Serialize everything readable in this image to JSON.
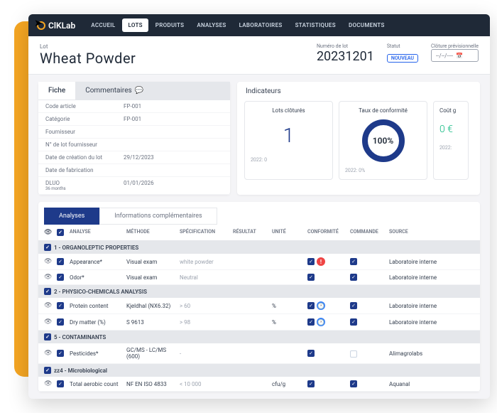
{
  "brand": "ClKLab",
  "nav": [
    "ACCUEIL",
    "LOTS",
    "PRODUITS",
    "ANALYSES",
    "LABORATOIRES",
    "STATISTIQUES",
    "DOCUMENTS"
  ],
  "nav_active": 1,
  "header": {
    "sub": "Lot",
    "title": "Wheat Powder",
    "lot_label": "Numéro de lot",
    "lot_value": "20231201",
    "status_label": "Statut",
    "status_value": "NOUVEAU",
    "close_label": "Clôture prévisionnelle",
    "close_value": "--/--/----"
  },
  "fiche": {
    "tab1": "Fiche",
    "tab2": "Commentaires",
    "rows": [
      {
        "k": "Code article",
        "v": "FP-001"
      },
      {
        "k": "Catégorie",
        "v": "FP-001"
      },
      {
        "k": "Fournisseur",
        "v": ""
      },
      {
        "k": "N° de lot fournisseur",
        "v": ""
      },
      {
        "k": "Date de création du lot",
        "v": "29/12/2023"
      },
      {
        "k": "Date de fabrication",
        "v": ""
      },
      {
        "k": "DLUO",
        "sub": "36 months",
        "v": "01/01/2026"
      }
    ]
  },
  "indicators": {
    "title": "Indicateurs",
    "cards": [
      {
        "title": "Lots clôturés",
        "value": "1",
        "foot": "2022: 0"
      },
      {
        "title": "Taux de conformité",
        "value": "100%",
        "foot": "2022: 0%",
        "type": "donut"
      },
      {
        "title": "Coût g",
        "value": "0 €",
        "foot": "2022:"
      }
    ]
  },
  "analyses": {
    "tab1": "Analyses",
    "tab2": "Informations complémentaires",
    "columns": [
      "",
      "",
      "ANALYSE",
      "MÉTHODE",
      "SPÉCIFICATION",
      "RÉSULTAT",
      "UNITÉ",
      "CONFORMITÉ",
      "COMMANDE",
      "SOURCE"
    ],
    "sections": [
      {
        "title": "1 - ORGANOLEPTIC PROPERTIES",
        "rows": [
          {
            "analyse": "Appearance*",
            "methode": "Visual exam",
            "spec": "white powder",
            "resultat": "",
            "unite": "",
            "conf": true,
            "conf_icon": "red",
            "cmd": true,
            "source": "Laboratoire interne"
          },
          {
            "analyse": "Odor*",
            "methode": "Visual exam",
            "spec": "Neutral",
            "resultat": "",
            "unite": "",
            "conf": true,
            "cmd": true,
            "source": "Laboratoire interne"
          }
        ]
      },
      {
        "title": "2 - PHYSICO-CHEMICALS ANALYSIS",
        "rows": [
          {
            "analyse": "Protein content",
            "methode": "Kjeldhal (NX6.32)",
            "spec": "> 60",
            "resultat": "",
            "unite": "%",
            "conf": true,
            "conf_icon": "blue",
            "cmd": true,
            "source": "Laboratoire interne"
          },
          {
            "analyse": "Dry matter (%)",
            "methode": "S 9613",
            "spec": "> 98",
            "resultat": "",
            "unite": "%",
            "conf": true,
            "conf_icon": "blue",
            "cmd": true,
            "source": "Laboratoire interne"
          }
        ]
      },
      {
        "title": "5 - CONTAMINANTS",
        "rows": [
          {
            "analyse": "Pesticides*",
            "methode": "GC/MS - LC/MS (600)",
            "spec": "-",
            "resultat": "",
            "unite": "",
            "conf": true,
            "cmd": false,
            "source": "Alimagrolabs"
          }
        ]
      },
      {
        "title": "zz4 - Microbiological",
        "rows": [
          {
            "analyse": "Total aerobic count",
            "methode": "NF EN ISO 4833",
            "spec": "< 10 000",
            "resultat": "",
            "unite": "cfu/g",
            "conf": true,
            "cmd": true,
            "source": "Aquanal"
          }
        ]
      }
    ]
  }
}
